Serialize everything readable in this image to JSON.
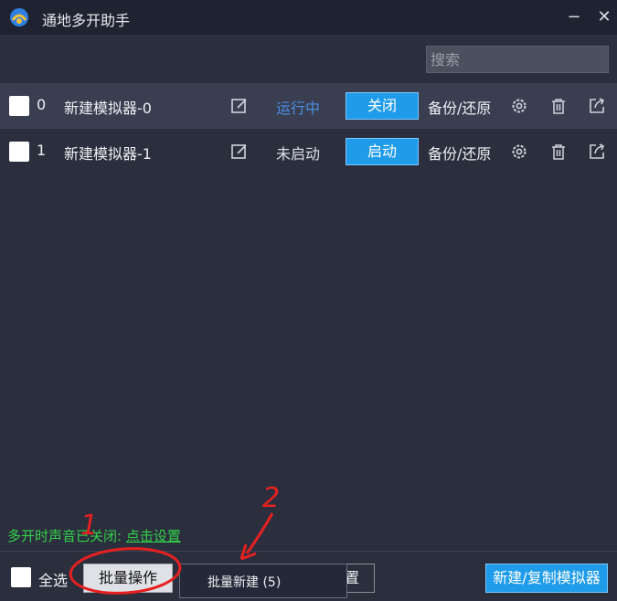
{
  "window": {
    "title": "通地多开助手",
    "minimize": "−",
    "close": "✕"
  },
  "search": {
    "placeholder": "搜索"
  },
  "emulators": [
    {
      "index": "0",
      "name": "新建模拟器-0",
      "status": "运行中",
      "action": "关闭",
      "backup": "备份/还原",
      "running": true
    },
    {
      "index": "1",
      "name": "新建模拟器-1",
      "status": "未启动",
      "action": "启动",
      "backup": "备份/还原",
      "running": false
    }
  ],
  "notice": {
    "text": "多开时声音已关闭: ",
    "link": "点击设置"
  },
  "footer": {
    "select_all": "全选",
    "bulk_ops": "批量操作",
    "hidden_btn_tail": "置",
    "dropdown_item": "批量新建 (5)",
    "new_copy": "新建/复制模拟器"
  },
  "annotations": {
    "step1": "1",
    "step2": "2",
    "color": "#e62020"
  },
  "colors": {
    "accent_blue": "#1e9be9",
    "running_text": "#4a8fe0",
    "notice_green": "#33d14a"
  }
}
